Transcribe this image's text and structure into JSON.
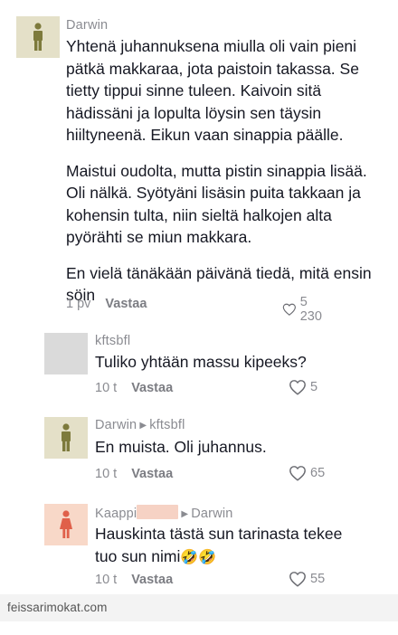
{
  "comments": [
    {
      "username": "Darwin",
      "reply_to": "",
      "paragraphs": [
        "Yhtenä juhannuksena miulla oli vain pieni pätkä makkaraa, jota paistoin takassa. Se tietty tippui sinne tuleen. Kaivoin sitä hädissäni ja lopulta löysin sen täysin hiiltyneenä. Eikun vaan sinappia päälle.",
        "Maistui oudolta, mutta pistin sinappia lisää. Oli nälkä. Syötyäni lisäsin puita takkaan ja kohensin tulta, niin sieltä halkojen alta pyörähti se miun makkara.",
        "En vielä tänäkään päivänä tiedä, mitä ensin söin"
      ],
      "time": "1 pv",
      "reply_label": "Vastaa",
      "likes": "5 230",
      "avatar_color": "#e4e0c8",
      "avatar_icon": "person-icon"
    },
    {
      "username": "kftsbfl",
      "reply_to": "",
      "text": "Tuliko yhtään massu kipeeks?",
      "time": "10 t",
      "reply_label": "Vastaa",
      "likes": "5",
      "avatar_color": "#dadada"
    },
    {
      "username": "Darwin",
      "reply_to": "kftsbfl",
      "text": "En muista. Oli juhannus.",
      "time": "10 t",
      "reply_label": "Vastaa",
      "likes": "65",
      "avatar_color": "#e4e0c8",
      "avatar_icon": "person-icon"
    },
    {
      "username": "Kaappi",
      "reply_to": "Darwin",
      "text": "Hauskinta tästä sun tarinasta tekee tuo sun nimi",
      "emoji": "🤣🤣",
      "time": "10 t",
      "reply_label": "Vastaa",
      "likes": "55",
      "avatar_color": "#f8d8c8",
      "avatar_icon": "woman-icon"
    }
  ],
  "footer": {
    "watermark": "feissarimokat.com"
  }
}
